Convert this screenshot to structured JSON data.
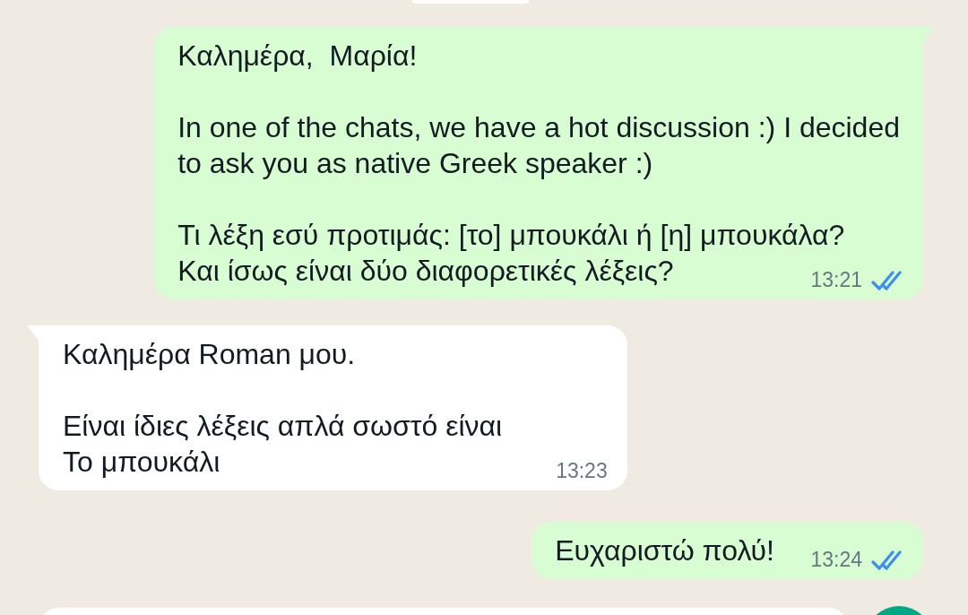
{
  "messages": [
    {
      "kind": "outgoing",
      "tail": true,
      "text": "Καλημέρα,  Μαρία!\n\nIn one of the chats, we have a hot discussion :) I decided\nto ask you as native Greek speaker :)\n\nΤι λέξη εσύ προτιμάς: [το] μπουκάλι ή [η] μπουκάλα?\nΚαι ίσως είναι δύο διαφορετικές λέξεις?",
      "time": "13:21",
      "read": true
    },
    {
      "kind": "incoming",
      "tail": true,
      "text": "Καλημέρα Roman μου.\n\nΕίναι ίδιες λέξεις απλά σωστό είναι\nΤο μπουκάλι",
      "time": "13:23"
    },
    {
      "kind": "outgoing",
      "tail": false,
      "text": "Ευχαριστώ πολύ!",
      "time": "13:24",
      "read": true
    }
  ]
}
